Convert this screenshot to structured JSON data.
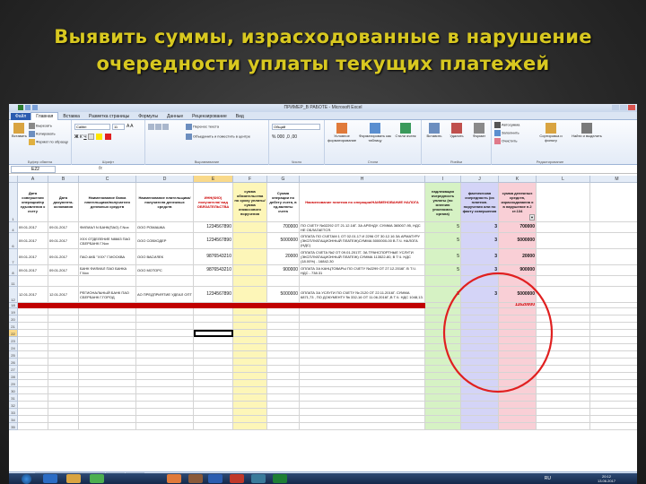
{
  "slide": {
    "title_line1": "Выявить суммы, израсходованные в нарушение",
    "title_line2": "очередности уплаты текущих платежей"
  },
  "window": {
    "title": "ПРИМЕР_В РАБОТЕ - Microsoft Excel"
  },
  "ribbon_tabs": [
    "Файл",
    "Главная",
    "Вставка",
    "Разметка страницы",
    "Формулы",
    "Данные",
    "Рецензирование",
    "Вид"
  ],
  "ribbon": {
    "paste": "Вставить",
    "cut": "Вырезать",
    "copy": "Копировать",
    "format_painter": "Формат по образцу",
    "group_clipboard": "Буфер обмена",
    "font_name": "Calibri",
    "font_size": "11",
    "group_font": "Шрифт",
    "wrap_text": "Перенос текста",
    "merge_center": "Объединить и поместить в центре",
    "group_alignment": "Выравнивание",
    "number_format": "Общий",
    "group_number": "Число",
    "conditional_format": "Условное форматирование",
    "format_as_table": "Форматировать как таблицу",
    "cell_styles": "Стили ячеек",
    "group_styles": "Стили",
    "insert": "Вставить",
    "delete": "Удалить",
    "format": "Формат",
    "group_cells": "Ячейки",
    "autosum": "Автосумма",
    "fill": "Заполнить",
    "clear": "Очистить",
    "sort_filter": "Сортировка и фильтр",
    "find_select": "Найти и выделить",
    "group_editing": "Редактирование"
  },
  "formula_bar": {
    "name_box": "E22",
    "fx": "fx",
    "content": ""
  },
  "columns": [
    "A",
    "B",
    "C",
    "D",
    "E",
    "F",
    "G",
    "H",
    "I",
    "J",
    "K",
    "L",
    "M"
  ],
  "headers": {
    "A": "Дата совершения операции/пр едъявления к счету",
    "B": "Дата документа-основания",
    "C": "Наименование банка плательщика/получателя денежных средств",
    "D": "Наименование плательщика/получателя денежных средств",
    "E": "ИНН(КИО) получателя/ вид ОБЯЗАТЕЛЬСТВА",
    "F": "сумма обязательства по сроку уплаты/ сумма инкассового поручения",
    "G": "Сумма операции по дебету счета, в ед.валюты счета",
    "H": "Наименование платежа по операции/НАИМЕНОВАНИЕ НАЛОГА",
    "I": "надлежащая очередность уплаты (по мнению уполномоч. органа)",
    "J": "фактическая очередность (из платежн. поручения или по факту совершения",
    "K": "сумма денежных средств, израсходованна я в нарушение п.2 ст.134",
    "K_filter": "▼"
  },
  "row_numbers": [
    "1",
    "4",
    "6",
    "7",
    "8",
    "11",
    "12",
    "18",
    "19",
    "20",
    "21",
    "22",
    "23",
    "24",
    "25",
    "26",
    "27",
    "28",
    "29",
    "30",
    "31",
    "32",
    "33",
    "34",
    "35"
  ],
  "rows": [
    {
      "num": "4",
      "A": "09.01.2017",
      "B": "09.01.2017",
      "C": "ФИЛИАЛ N БАНК(ПАО) Г.Nox",
      "D": "ООО РОМАШКА",
      "E": "1234567890",
      "G": "700000",
      "H": "ПО СЧЕТУ №02292 ОТ 21.12.16Г. ЗА АРЕНДУ. СУММА 365007-95, НДС НЕ ОБЛАГАЕТСЯ.",
      "I": "5",
      "J": "3",
      "K": "700000"
    },
    {
      "num": "6",
      "A": "09.01.2017",
      "B": "09.01.2017",
      "C": "ХХХ ОТДЕЛЕНИЕ N8663 ПАО СБЕРБАНК Г.Nox",
      "D": "ООО СОВХОДЕР",
      "E": "1234567890",
      "G": "5000000",
      "H": "ОПЛАТА ПО СЧЕТАМ 1 ОТ 02.01.17 И 2296 ОТ 30.12.16 ЗА АРМАТУРУ (ЭКСПЛУАТАЦИОННЫЙ ПЛАТЕЖ)СУММА 5000000-00 В.Т.Ч. НАЛОГА (НДС)",
      "I": "5",
      "J": "3",
      "K": "5000000"
    },
    {
      "num": "7",
      "A": "09.01.2017",
      "B": "09.01.2017",
      "C": "ПАО АКБ \"ХХХ\" Г.МОСКВА",
      "D": "ООО ВАСИЛЕК",
      "E": "9876543210",
      "G": "20000",
      "H": "ОПЛАТА СЧЕТА №2 ОТ 09.01.2017Г. ЗА ТРАНСПОРТНЫЕ УСЛУГИ (ЭКСПЛУАТАЦИОННЫЙ ПЛАТЕЖ) СУММА 113522-80, В Т.Ч. НДС (18.00%) - 16842-30",
      "I": "5",
      "J": "3",
      "K": "20000"
    },
    {
      "num": "8",
      "A": "09.01.2017",
      "B": "09.01.2017",
      "C": "БАНК ФИЛИАЛ ПАО БАНКА Г.Nox",
      "D": "ООО МОТОРС",
      "E": "9876543210",
      "G": "900000",
      "H": "ОПЛАТА ЗА КАНЦТОВАРЫ ПО СЧЕТУ №2299 ОТ 27.12.2016Г. В Т.Ч. НДС - 738.31",
      "I": "5",
      "J": "3",
      "K": "900000"
    },
    {
      "num": "11",
      "A": "",
      "B": "",
      "C": "",
      "D": "",
      "E": "",
      "G": "",
      "H": "",
      "I": "",
      "J": "",
      "K": ""
    },
    {
      "num": "12",
      "A": "12.01.2017",
      "B": "12.01.2017",
      "C": "РЕГИОНАЛЬНЫЙ БАНК ПАО СБЕРБАНК Г.ГОРОД",
      "D": "АО ПРЕДПРИЯТИЕ УДЕАЛ ОПТ",
      "E": "1234567890",
      "G": "5000000",
      "H": "ОПЛАТА ЗА УСЛУГИ ПО СЧЕТУ № 2120 ОТ 22.11.2016Г. СУММА 6871,73 , ПО ДОКУМЕНТУ № 332-16 ОТ 11.06.2016Г.,В Т.Ч. НДС 1048,13.",
      "I": "5",
      "J": "3",
      "K": "5000000"
    }
  ],
  "total": {
    "num": "18",
    "K": "11620000"
  },
  "sheet_tabs": [
    "Операции, совершенные по счету",
    "Лист2",
    "Лист3"
  ],
  "status": "Готово   Найдено записей: 5 из 17",
  "taskbar": {
    "lang": "RU",
    "time": "20:12",
    "date": "13.06.2017"
  },
  "colors": {
    "title": "#d8c820",
    "total_bar": "#c00000",
    "col_F_fill": "#fdf6b8",
    "col_I_fill": "#d6f2c4",
    "col_J_fill": "#d4d4f7",
    "col_K_fill": "#f9cfd6",
    "annotation_circle": "#e02020"
  }
}
